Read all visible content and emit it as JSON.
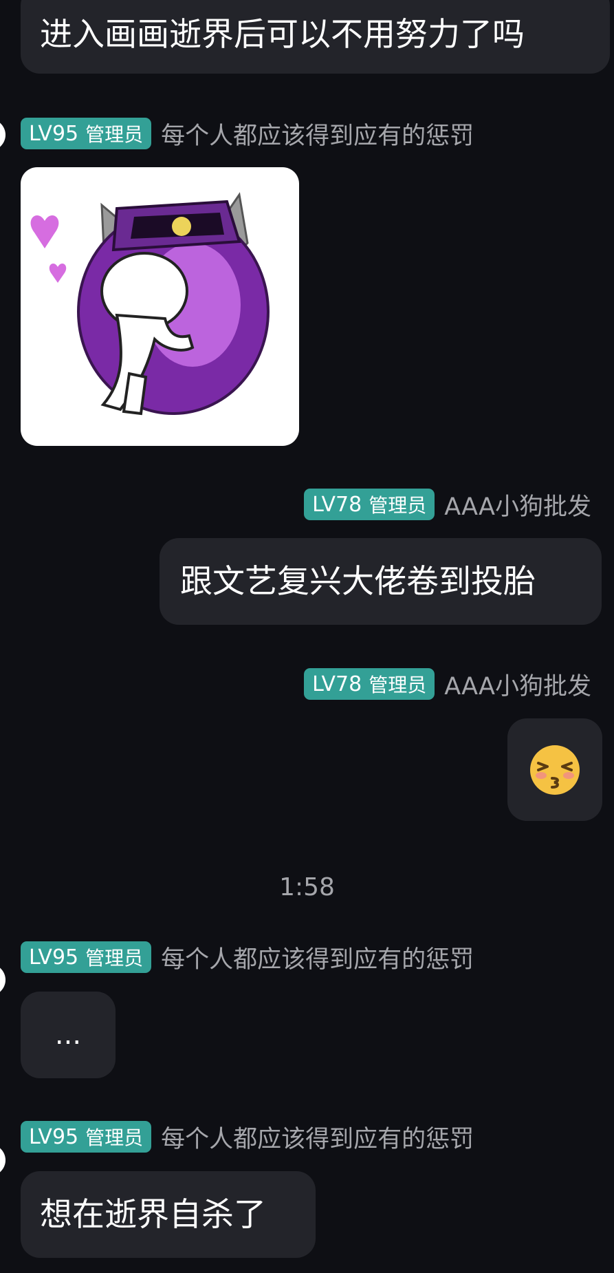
{
  "messages": [
    {
      "direction": "incoming",
      "text": "进入画画逝界后可以不用努力了吗"
    },
    {
      "direction": "incoming",
      "level": "LV95",
      "role": "管理员",
      "sender": "每个人都应该得到应有的惩罚",
      "content": "sticker",
      "sticker_icon": "purple-helmet-hug-sticker-icon"
    },
    {
      "direction": "outgoing",
      "level": "LV78",
      "role": "管理员",
      "sender": "AAA小狗批发",
      "text": "跟文艺复兴大佬卷到投胎"
    },
    {
      "direction": "outgoing",
      "level": "LV78",
      "role": "管理员",
      "sender": "AAA小狗批发",
      "content": "emoji",
      "emoji": "😚"
    },
    {
      "direction": "incoming",
      "level": "LV95",
      "role": "管理员",
      "sender": "每个人都应该得到应有的惩罚",
      "text": "..."
    },
    {
      "direction": "incoming",
      "level": "LV95",
      "role": "管理员",
      "sender": "每个人都应该得到应有的惩罚",
      "text": "想在逝界自杀了"
    }
  ],
  "timestamp": "1:58",
  "colors": {
    "background": "#0e0f14",
    "bubble": "#23242a",
    "badge": "#33a096",
    "sender_text": "#a5a6ab"
  }
}
